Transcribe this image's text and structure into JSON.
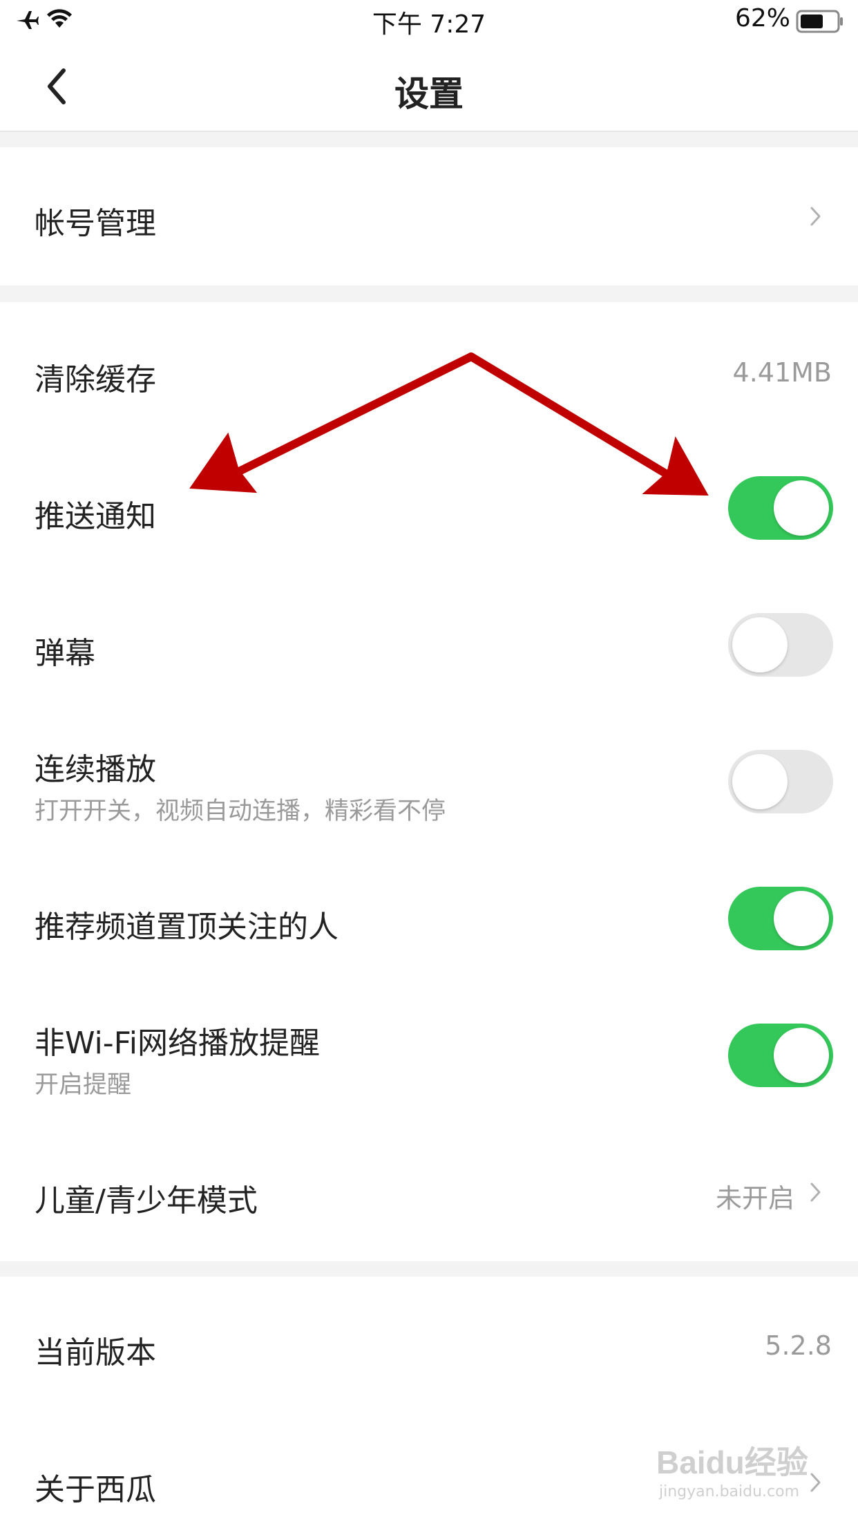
{
  "status_bar": {
    "time": "下午 7:27",
    "battery_percent": "62%",
    "icons": [
      "airplane-icon",
      "wifi-icon",
      "battery-icon"
    ]
  },
  "nav": {
    "title": "设置",
    "back_icon": "chevron-left-icon"
  },
  "sections": {
    "account": {
      "label": "帐号管理"
    },
    "cache": {
      "label": "清除缓存",
      "value": "4.41MB"
    },
    "push": {
      "label": "推送通知",
      "toggle": "on"
    },
    "danmaku": {
      "label": "弹幕",
      "toggle": "off"
    },
    "autoplay": {
      "label": "连续播放",
      "sublabel": "打开开关，视频自动连播，精彩看不停",
      "toggle": "off"
    },
    "pinned": {
      "label": "推荐频道置顶关注的人",
      "toggle": "on"
    },
    "wifi": {
      "label": "非Wi-Fi网络播放提醒",
      "sublabel": "开启提醒",
      "toggle": "on"
    },
    "kids": {
      "label": "儿童/青少年模式",
      "value": "未开启"
    },
    "version": {
      "label": "当前版本",
      "value": "5.2.8"
    },
    "about": {
      "label": "关于西瓜"
    }
  },
  "watermark": {
    "brand": "Baidu经验",
    "url": "jingyan.baidu.com"
  },
  "colors": {
    "toggle_on": "#34c759",
    "toggle_off": "#e6e6e6",
    "arrow": "#c00000",
    "section_gap": "#f3f3f3"
  }
}
